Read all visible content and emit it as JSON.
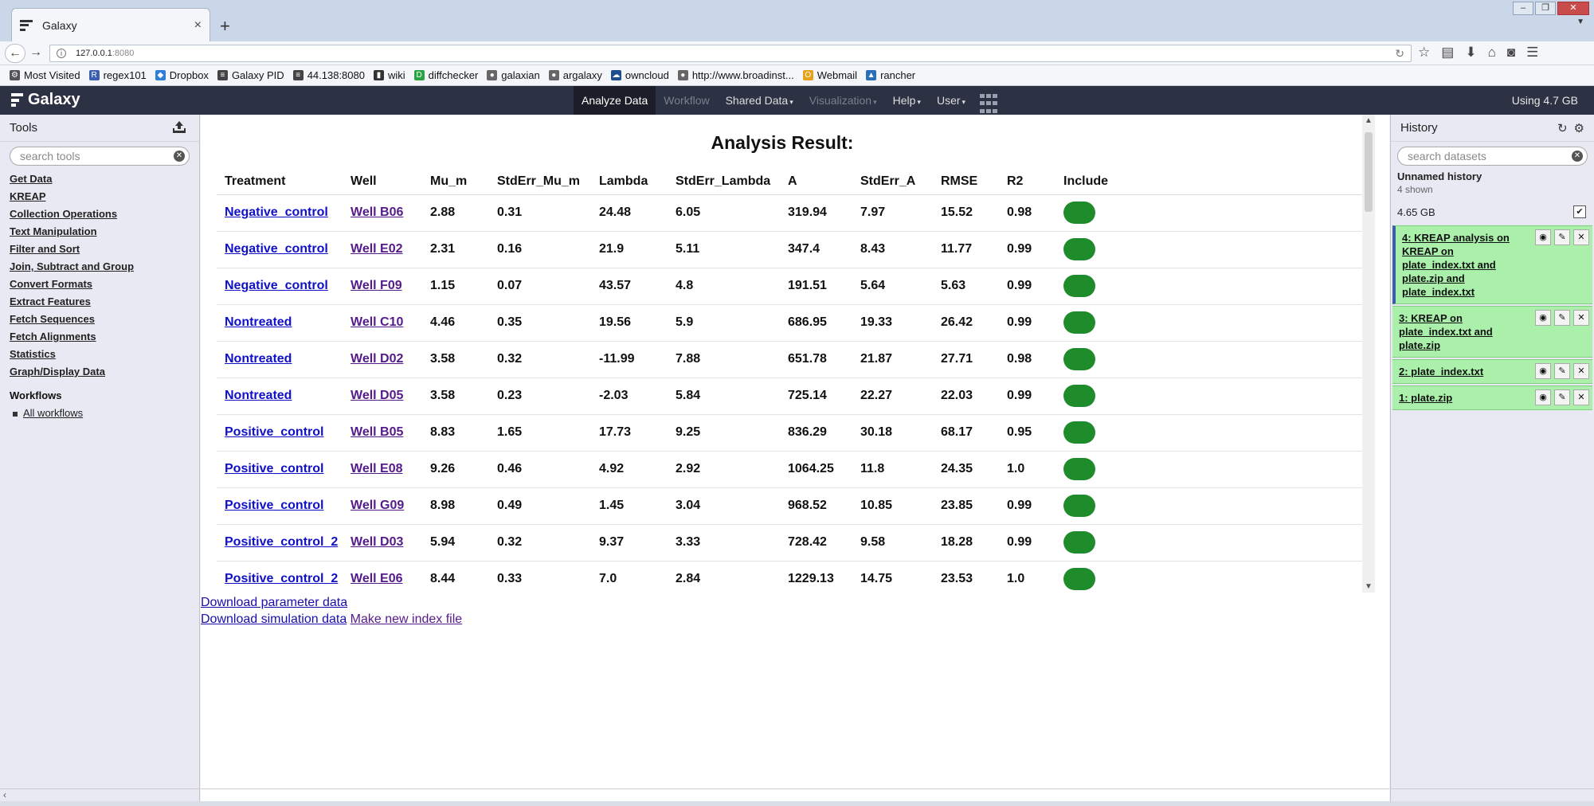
{
  "browser": {
    "tab_title": "Galaxy",
    "tab_close": "×",
    "new_tab": "+",
    "url_host": "127.0.0.1",
    "url_port": ":8080",
    "bookmarks": [
      {
        "label": "Most Visited",
        "icon": "gear-icon",
        "color": "#555555",
        "glyph": "⚙"
      },
      {
        "label": "regex101",
        "icon": "regex-icon",
        "color": "#3a5fb0",
        "glyph": "R"
      },
      {
        "label": "Dropbox",
        "icon": "dropbox-icon",
        "color": "#2f7fd8",
        "glyph": "◆"
      },
      {
        "label": "Galaxy PID",
        "icon": "galaxy-icon",
        "color": "#444444",
        "glyph": "≡"
      },
      {
        "label": "44.138:8080",
        "icon": "galaxy-icon",
        "color": "#444444",
        "glyph": "≡"
      },
      {
        "label": "wiki",
        "icon": "bars-icon",
        "color": "#333333",
        "glyph": "▮"
      },
      {
        "label": "diffchecker",
        "icon": "diffchecker-icon",
        "color": "#2aa344",
        "glyph": "D"
      },
      {
        "label": "galaxian",
        "icon": "globe-icon",
        "color": "#666666",
        "glyph": "●"
      },
      {
        "label": "argalaxy",
        "icon": "globe-icon",
        "color": "#666666",
        "glyph": "●"
      },
      {
        "label": "owncloud",
        "icon": "cloud-icon",
        "color": "#1d4f8f",
        "glyph": "☁"
      },
      {
        "label": "http://www.broadinst...",
        "icon": "globe-icon",
        "color": "#666666",
        "glyph": "●"
      },
      {
        "label": "Webmail",
        "icon": "mail-icon",
        "color": "#e8a21a",
        "glyph": "O"
      },
      {
        "label": "rancher",
        "icon": "rancher-icon",
        "color": "#2a6fb8",
        "glyph": "▲"
      }
    ]
  },
  "masthead": {
    "brand": "Galaxy",
    "nav": [
      {
        "label": "Analyze Data",
        "state": "active",
        "caret": ""
      },
      {
        "label": "Workflow",
        "state": "disabled",
        "caret": ""
      },
      {
        "label": "Shared Data",
        "state": "normal",
        "caret": "▾"
      },
      {
        "label": "Visualization",
        "state": "disabled",
        "caret": "▾"
      },
      {
        "label": "Help",
        "state": "normal",
        "caret": "▾"
      },
      {
        "label": "User",
        "state": "normal",
        "caret": "▾"
      }
    ],
    "quota": "Using 4.7 GB"
  },
  "tools": {
    "title": "Tools",
    "search_placeholder": "search tools",
    "sections": [
      "Get Data",
      "KREAP",
      "Collection Operations",
      "Text Manipulation",
      "Filter and Sort",
      "Join, Subtract and Group",
      "Convert Formats",
      "Extract Features",
      "Fetch Sequences",
      "Fetch Alignments",
      "Statistics",
      "Graph/Display Data"
    ],
    "workflows_title": "Workflows",
    "workflows_item": "All workflows"
  },
  "analysis": {
    "title": "Analysis Result:",
    "columns": [
      "Treatment",
      "Well",
      "Mu_m",
      "StdErr_Mu_m",
      "Lambda",
      "StdErr_Lambda",
      "A",
      "StdErr_A",
      "RMSE",
      "R2",
      "Include"
    ],
    "rows": [
      {
        "treatment": "Negative_control",
        "well": "Well B06",
        "mu": "2.88",
        "se_mu": "0.31",
        "lambda": "24.48",
        "se_lambda": "6.05",
        "a": "319.94",
        "se_a": "7.97",
        "rmse": "15.52",
        "r2": "0.98"
      },
      {
        "treatment": "Negative_control",
        "well": "Well E02",
        "mu": "2.31",
        "se_mu": "0.16",
        "lambda": "21.9",
        "se_lambda": "5.11",
        "a": "347.4",
        "se_a": "8.43",
        "rmse": "11.77",
        "r2": "0.99"
      },
      {
        "treatment": "Negative_control",
        "well": "Well F09",
        "mu": "1.15",
        "se_mu": "0.07",
        "lambda": "43.57",
        "se_lambda": "4.8",
        "a": "191.51",
        "se_a": "5.64",
        "rmse": "5.63",
        "r2": "0.99"
      },
      {
        "treatment": "Nontreated",
        "well": "Well C10",
        "mu": "4.46",
        "se_mu": "0.35",
        "lambda": "19.56",
        "se_lambda": "5.9",
        "a": "686.95",
        "se_a": "19.33",
        "rmse": "26.42",
        "r2": "0.99"
      },
      {
        "treatment": "Nontreated",
        "well": "Well D02",
        "mu": "3.58",
        "se_mu": "0.32",
        "lambda": "-11.99",
        "se_lambda": "7.88",
        "a": "651.78",
        "se_a": "21.87",
        "rmse": "27.71",
        "r2": "0.98"
      },
      {
        "treatment": "Nontreated",
        "well": "Well D05",
        "mu": "3.58",
        "se_mu": "0.23",
        "lambda": "-2.03",
        "se_lambda": "5.84",
        "a": "725.14",
        "se_a": "22.27",
        "rmse": "22.03",
        "r2": "0.99"
      },
      {
        "treatment": "Positive_control",
        "well": "Well B05",
        "mu": "8.83",
        "se_mu": "1.65",
        "lambda": "17.73",
        "se_lambda": "9.25",
        "a": "836.29",
        "se_a": "30.18",
        "rmse": "68.17",
        "r2": "0.95"
      },
      {
        "treatment": "Positive_control",
        "well": "Well E08",
        "mu": "9.26",
        "se_mu": "0.46",
        "lambda": "4.92",
        "se_lambda": "2.92",
        "a": "1064.25",
        "se_a": "11.8",
        "rmse": "24.35",
        "r2": "1.0"
      },
      {
        "treatment": "Positive_control",
        "well": "Well G09",
        "mu": "8.98",
        "se_mu": "0.49",
        "lambda": "1.45",
        "se_lambda": "3.04",
        "a": "968.52",
        "se_a": "10.85",
        "rmse": "23.85",
        "r2": "0.99"
      },
      {
        "treatment": "Positive_control_2",
        "well": "Well D03",
        "mu": "5.94",
        "se_mu": "0.32",
        "lambda": "9.37",
        "se_lambda": "3.33",
        "a": "728.42",
        "se_a": "9.58",
        "rmse": "18.28",
        "r2": "0.99"
      },
      {
        "treatment": "Positive_control_2",
        "well": "Well E06",
        "mu": "8.44",
        "se_mu": "0.33",
        "lambda": "7.0",
        "se_lambda": "2.84",
        "a": "1229.13",
        "se_a": "14.75",
        "rmse": "23.53",
        "r2": "1.0"
      }
    ],
    "links": {
      "download_params": "Download parameter data",
      "download_sim": "Download simulation data",
      "new_index": "Make new index file"
    }
  },
  "history": {
    "title": "History",
    "search_placeholder": "search datasets",
    "name": "Unnamed history",
    "shown": "4 shown",
    "size": "4.65 GB",
    "datasets": [
      {
        "label": "4: KREAP analysis on KREAP on plate_index.txt and plate.zip and plate_index.txt",
        "current": true
      },
      {
        "label": "3: KREAP on plate_index.txt and plate.zip",
        "current": false
      },
      {
        "label": "2: plate_index.txt",
        "current": false
      },
      {
        "label": "1: plate.zip",
        "current": false
      }
    ]
  },
  "colors": {
    "masthead_bg": "#2c3143",
    "panel_bg": "#e8e9f2",
    "dataset_ok": "#aaf0aa",
    "include_toggle": "#1f8c2c"
  }
}
